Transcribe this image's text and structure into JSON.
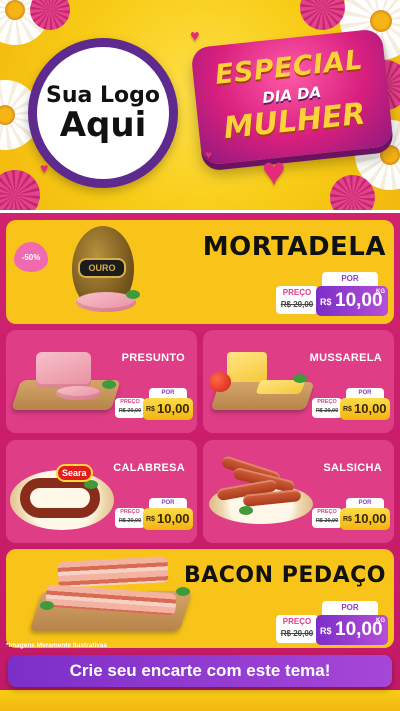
{
  "header": {
    "logo_line1": "Sua Logo",
    "logo_line2": "Aqui",
    "badge_line1": "ESPECIAL",
    "badge_line2": "DIA DA",
    "badge_line3": "MULHER"
  },
  "products": {
    "mortadela": {
      "name": "MORTADELA",
      "discount": "-50%",
      "brand_label": "OURO",
      "preco_label": "PREÇO",
      "old_price": "R$ 20,00",
      "por_label": "POR",
      "currency": "R$",
      "new_price": "10,00",
      "unit": "KG"
    },
    "presunto": {
      "name": "PRESUNTO",
      "preco_label": "PREÇO",
      "old_price": "R$ 20,00",
      "por_label": "POR",
      "currency": "R$",
      "new_price": "10,00"
    },
    "mussarela": {
      "name": "MUSSARELA",
      "preco_label": "PREÇO",
      "old_price": "R$ 20,00",
      "por_label": "POR",
      "currency": "R$",
      "new_price": "10,00"
    },
    "calabresa": {
      "name": "CALABRESA",
      "brand_label": "Seara",
      "preco_label": "PREÇO",
      "old_price": "R$ 20,00",
      "por_label": "POR",
      "currency": "R$",
      "new_price": "10,00"
    },
    "salsicha": {
      "name": "SALSICHA",
      "preco_label": "PREÇO",
      "old_price": "R$ 20,00",
      "por_label": "POR",
      "currency": "R$",
      "new_price": "10,00"
    },
    "bacon": {
      "name": "BACON PEDAÇO",
      "preco_label": "PREÇO",
      "old_price": "R$ 20,00",
      "por_label": "POR",
      "currency": "R$",
      "new_price": "10,00",
      "unit": "KG"
    }
  },
  "footnote": "*Imagens Meramente Ilustrativas",
  "cta_label": "Crie seu encarte com este tema!",
  "colors": {
    "yellow": "#f8c419",
    "pink": "#e03d87",
    "magenta_bg": "#d0226f",
    "purple": "#7b2ec7"
  }
}
